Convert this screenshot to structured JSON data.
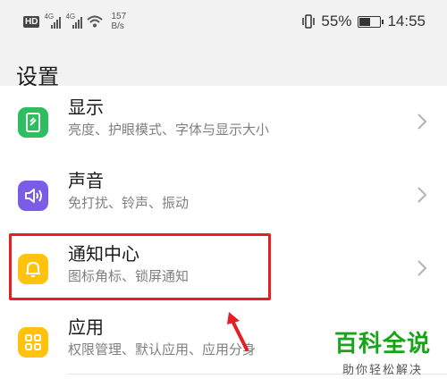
{
  "status_bar": {
    "hd_label": "HD",
    "network_1": "4G",
    "network_2": "4G",
    "speed_value": "157",
    "speed_unit": "B/s",
    "battery": "55%",
    "battery_level_percent": 55,
    "time": "14:55"
  },
  "page": {
    "title": "设置"
  },
  "items": [
    {
      "label": "显示",
      "sublabel": "亮度、护眼模式、字体与显示大小",
      "icon": "display-icon",
      "color": "#2dbe60"
    },
    {
      "label": "声音",
      "sublabel": "免打扰、铃声、振动",
      "icon": "sound-icon",
      "color": "#7b5ce6"
    },
    {
      "label": "通知中心",
      "sublabel": "图标角标、锁屏通知",
      "icon": "bell-icon",
      "color": "#ffc20e"
    },
    {
      "label": "应用",
      "sublabel": "权限管理、默认应用、应用分身",
      "icon": "apps-grid-icon",
      "color": "#ffc20e"
    }
  ],
  "watermark": {
    "title": "百科全说",
    "subtitle": "助你轻松解决"
  },
  "colors": {
    "highlight": "#e51e25",
    "background": "#f2f2f2"
  }
}
